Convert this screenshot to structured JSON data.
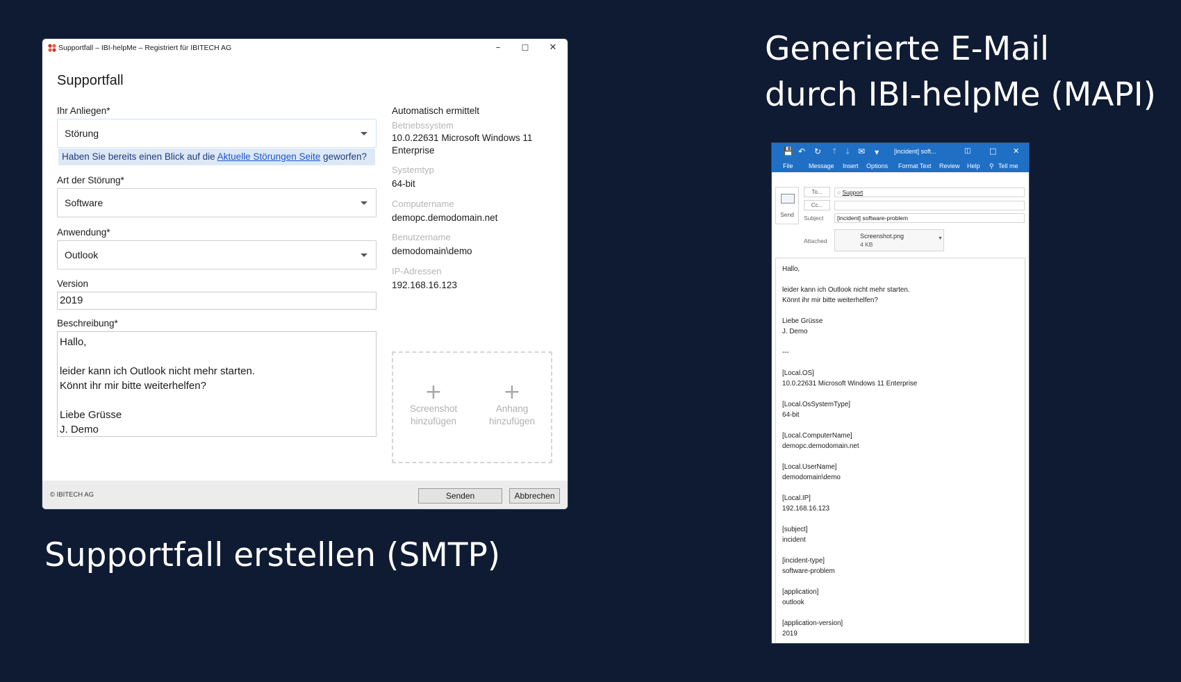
{
  "captions": {
    "left": "Supportfall erstellen (SMTP)",
    "right_line1": "Generierte E-Mail",
    "right_line2": "durch IBI-helpMe (MAPI)"
  },
  "support_window": {
    "title": "Supportfall – IBI-helpMe – Registriert für IBITECH AG",
    "controls": {
      "minimize": "–",
      "maximize": "☐",
      "close": "✕"
    },
    "heading": "Supportfall",
    "anliegen": {
      "label": "Ihr Anliegen*",
      "value": "Störung"
    },
    "hint": {
      "prefix": "Haben Sie bereits einen Blick auf die ",
      "link": "Aktuelle Störungen Seite",
      "suffix": " geworfen?"
    },
    "art": {
      "label": "Art der Störung*",
      "value": "Software"
    },
    "anwendung": {
      "label": "Anwendung*",
      "value": "Outlook"
    },
    "version": {
      "label": "Version",
      "value": "2019"
    },
    "beschreibung": {
      "label": "Beschreibung*",
      "value": "Hallo,\n\nleider kann ich Outlook nicht mehr starten.\nKönnt ihr mir bitte weiterhelfen?\n\nLiebe Grüsse\nJ. Demo"
    },
    "auto": {
      "heading": "Automatisch ermittelt",
      "os_label": "Betriebssystem",
      "os_value": "10.0.22631 Microsoft Windows 11 Enterprise",
      "systype_label": "Systemtyp",
      "systype_value": "64-bit",
      "computer_label": "Computername",
      "computer_value": "demopc.demodomain.net",
      "user_label": "Benutzername",
      "user_value": "demodomain\\demo",
      "ip_label": "IP-Adressen",
      "ip_value": "192.168.16.123"
    },
    "attach": {
      "screenshot_line1": "Screenshot",
      "screenshot_line2": "hinzufügen",
      "file_line1": "Anhang",
      "file_line2": "hinzufügen",
      "plus": "+"
    },
    "footer": {
      "copyright": "© IBITECH AG",
      "send": "Senden",
      "cancel": "Abbrechen"
    }
  },
  "outlook": {
    "title": "[incident] soft...",
    "tabs": [
      "File",
      "Message",
      "Insert",
      "Options",
      "Format Text",
      "Review",
      "Help",
      "Tell me"
    ],
    "send_label": "Send",
    "to_button": "To...",
    "cc_button": "Cc...",
    "to_value": "Support",
    "subject_label": "Subject",
    "subject_value": "[incident] software-problem",
    "attached_label": "Attached",
    "attachment_name": "Screenshot.png",
    "attachment_size": "4 KB",
    "body": "Hallo,\n\nleider kann ich Outlook nicht mehr starten.\nKönnt ihr mir bitte weiterhelfen?\n\nLiebe Grüsse\nJ. Demo\n\n---\n\n[Local.OS]\n10.0.22631 Microsoft Windows 11 Enterprise\n\n[Local.OsSystemType]\n64-bit\n\n[Local.ComputerName]\ndemopc.demodomain.net\n\n[Local.UserName]\ndemodomain\\demo\n\n[Local.IP]\n192.168.16.123\n\n[subject]\nincident\n\n[incident-type]\nsoftware-problem\n\n[application]\noutlook\n\n[application-version]\n2019"
  }
}
